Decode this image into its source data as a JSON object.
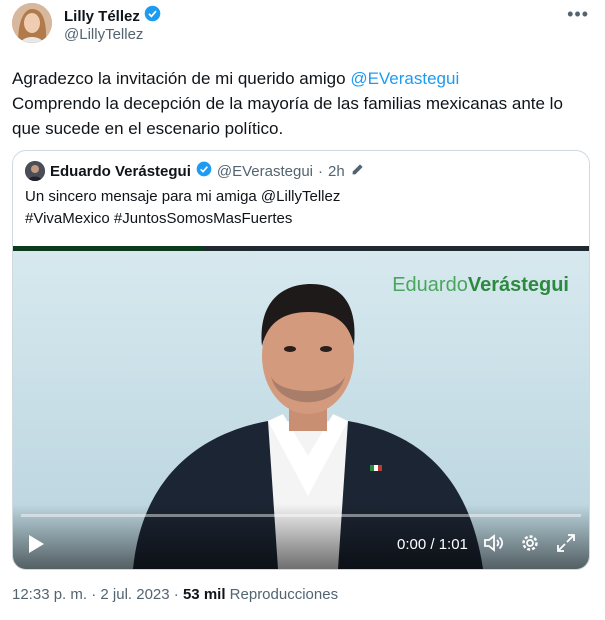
{
  "author": {
    "display_name": "Lilly Téllez",
    "handle": "@LillyTellez"
  },
  "post": {
    "line1_text": "Agradezco la invitación de mi querido amigo ",
    "line1_mention": "@EVerastegui",
    "line2_text": "Comprendo la decepción de la mayoría de las familias mexicanas ante lo que sucede en el escenario político."
  },
  "quote": {
    "display_name": "Eduardo Verástegui",
    "handle": "@EVerastegui",
    "separator": "·",
    "time": "2h",
    "line1": "Un sincero mensaje para mi amiga @LillyTellez",
    "line2": "#VivaMexico #JuntosSomosMasFuertes",
    "video": {
      "brand_light": "Eduardo",
      "brand_bold": "Verástegui",
      "time_display": "0:00 / 1:01",
      "progress_fraction": 0
    }
  },
  "footer": {
    "time": "12:33 p. m.",
    "sep1": "·",
    "date": "2 jul. 2023",
    "sep2": "·",
    "views_count": "53 mil",
    "views_label": "Reproducciones"
  },
  "colors": {
    "accent": "#1d9bf0",
    "verified": "#1d9bf0",
    "brand_green": "#2c8a3e"
  },
  "icons": [
    "verified-badge-icon",
    "more-icon",
    "edit-icon",
    "play-icon",
    "volume-icon",
    "settings-icon",
    "fullscreen-icon"
  ]
}
